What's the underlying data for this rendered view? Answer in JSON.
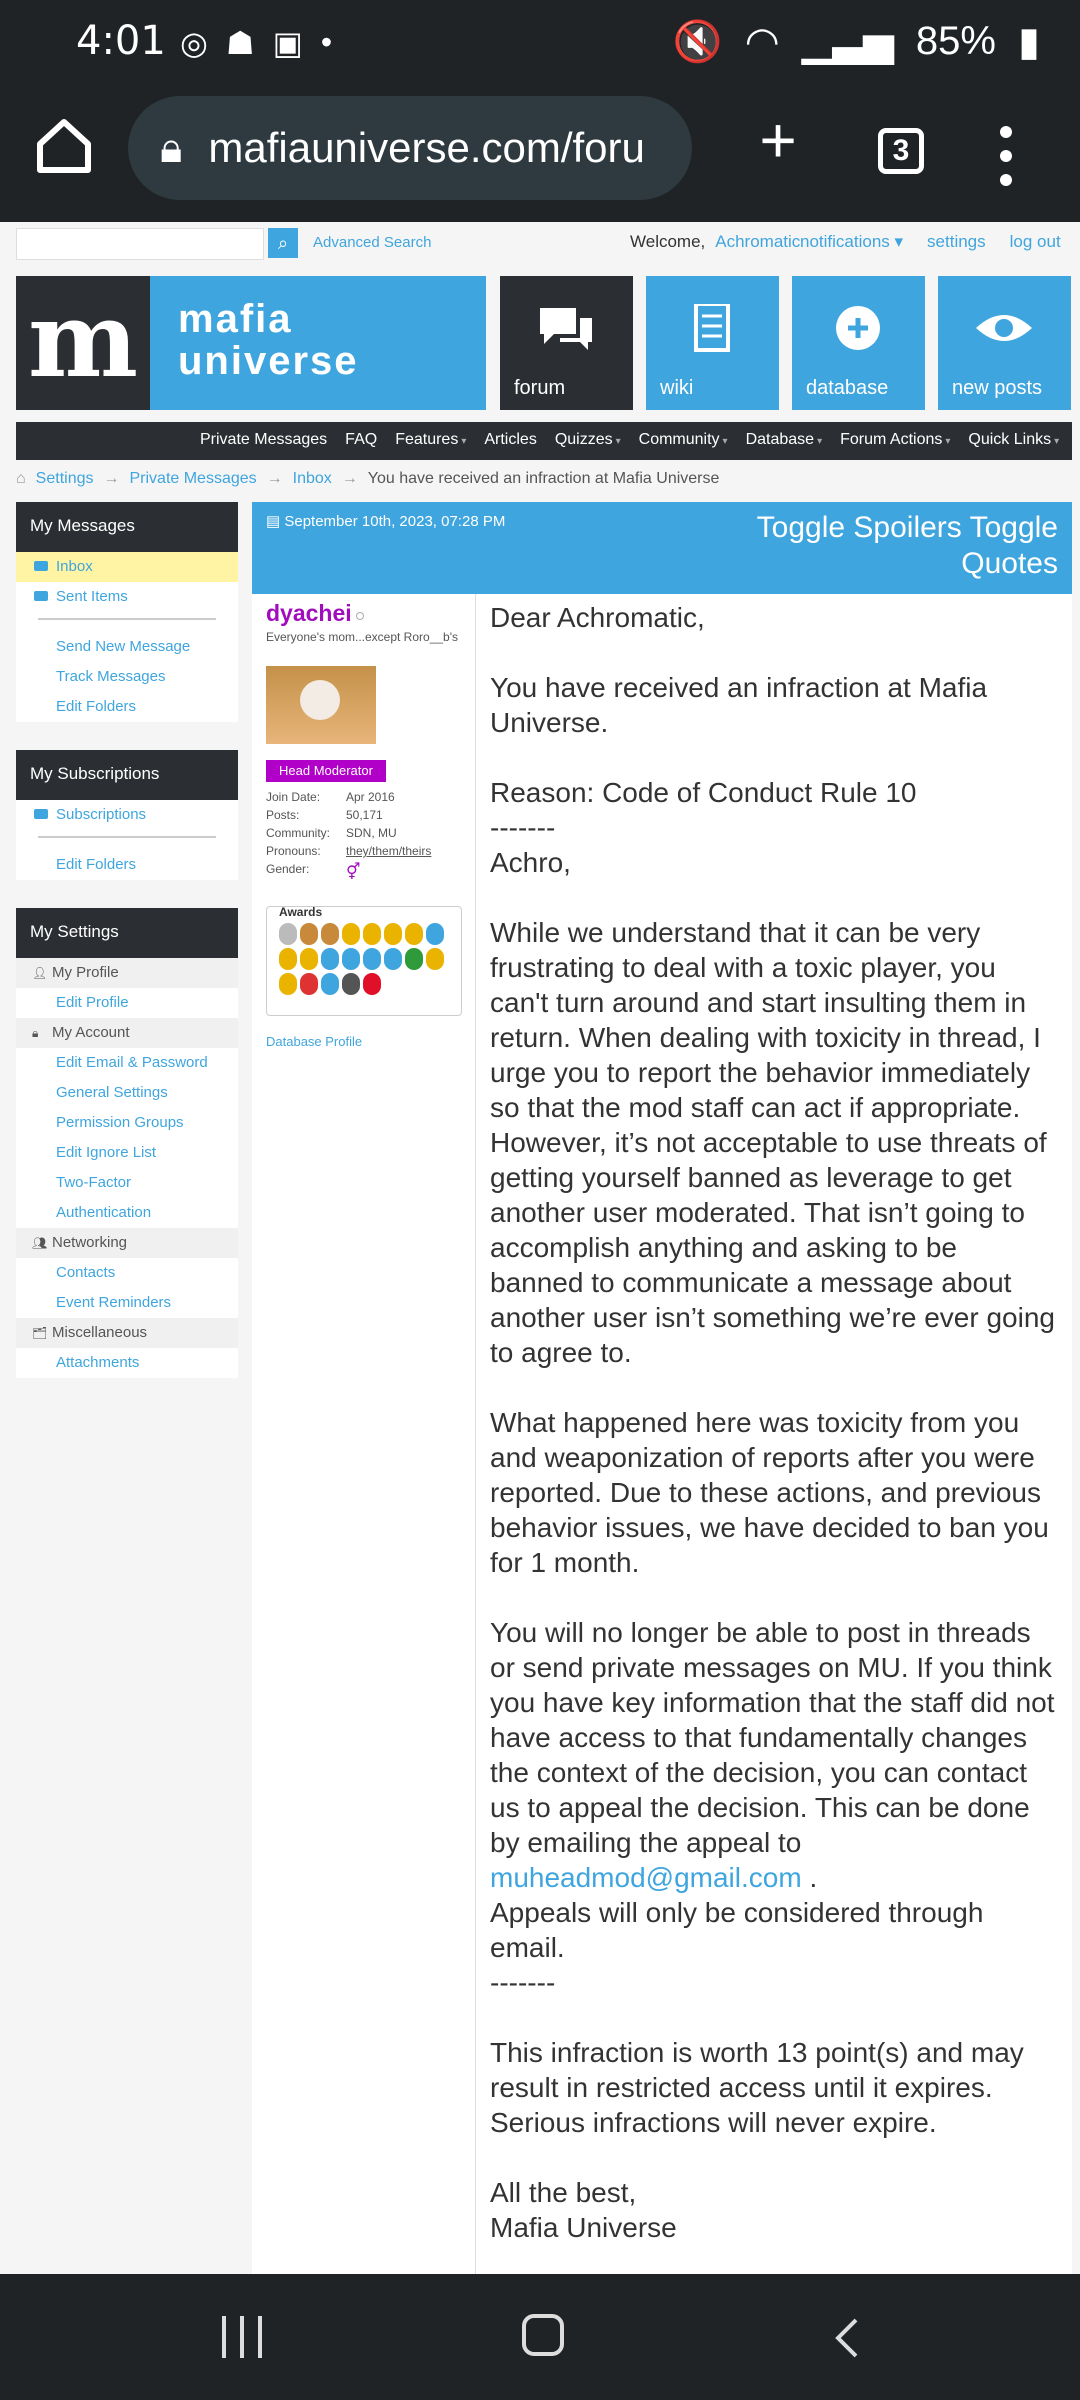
{
  "status_bar": {
    "time": "4:01",
    "battery": "85%"
  },
  "browser": {
    "url": "mafiauniverse.com/foru",
    "tab_count": "3"
  },
  "top": {
    "advanced_search": "Advanced Search",
    "welcome": "Welcome,",
    "username": "Achromatic",
    "notifications": "notifications",
    "settings": "settings",
    "logout": "log out"
  },
  "banner": {
    "logo_line1": "mafia",
    "logo_line2": "universe",
    "tiles": [
      "forum",
      "wiki",
      "database",
      "new posts"
    ]
  },
  "navbar": [
    "Private Messages",
    "FAQ",
    "Features",
    "Articles",
    "Quizzes",
    "Community",
    "Database",
    "Forum Actions",
    "Quick Links"
  ],
  "breadcrumb": {
    "items": [
      "Settings",
      "Private Messages",
      "Inbox"
    ],
    "current": "You have received an infraction at Mafia Universe"
  },
  "sidebar": {
    "messages": {
      "title": "My Messages",
      "inbox": "Inbox",
      "sent": "Sent Items",
      "send_new": "Send New Message",
      "track": "Track Messages",
      "edit_folders": "Edit Folders"
    },
    "subscriptions": {
      "title": "My Subscriptions",
      "subscriptions": "Subscriptions",
      "edit_folders": "Edit Folders"
    },
    "settings": {
      "title": "My Settings",
      "profile_header": "My Profile",
      "edit_profile": "Edit Profile",
      "account_header": "My Account",
      "edit_email": "Edit Email & Password",
      "general": "General Settings",
      "permission": "Permission Groups",
      "ignore": "Edit Ignore List",
      "two_factor": "Two-Factor",
      "authentication": "Authentication",
      "networking_header": "Networking",
      "contacts": "Contacts",
      "event_reminders": "Event Reminders",
      "misc_header": "Miscellaneous",
      "attachments": "Attachments"
    }
  },
  "post": {
    "date": "September 10th, 2023, 07:28 PM",
    "toggles": "Toggle Spoilers Toggle Quotes",
    "user": {
      "name": "dyachei",
      "title": "Everyone's mom...except Roro__b's",
      "badge": "Head Moderator",
      "join_label": "Join Date:",
      "join": "Apr 2016",
      "posts_label": "Posts:",
      "posts": "50,171",
      "community_label": "Community:",
      "community": "SDN, MU",
      "pronouns_label": "Pronouns:",
      "pronouns": "they/them/theirs",
      "gender_label": "Gender:",
      "awards_label": "Awards",
      "db_profile": "Database Profile"
    },
    "body": {
      "p1": "Dear Achromatic,",
      "p2": "You have received an infraction at Mafia Universe.",
      "p3": "Reason: Code of Conduct Rule 10\n-------\nAchro,",
      "p4": "While we understand that it can be very frustrating to deal with a toxic player, you can't turn around and start insulting them in return. When dealing with toxicity in thread, I urge you to report the behavior immediately so that the mod staff can act if appropriate. However, it’s not acceptable to use threats of getting yourself banned as leverage to get another user moderated. That isn’t going to accomplish anything and asking to be banned to communicate a message about another user isn’t something we’re ever going to agree to.",
      "p5": "What happened here was toxicity from you and weaponization of reports after you were reported. Due to these actions, and previous behavior issues, we have decided to ban you for 1 month.",
      "p6a": "You will no longer be able to post in threads or send private messages on MU. If you think you have key information that the staff did not have access to that fundamentally changes the context of the decision, you can contact us to appeal the decision. This can be done by emailing the appeal to ",
      "email": "muheadmod@gmail.com",
      "p6b": " .\nAppeals will only be considered through email.\n-------",
      "p7": "This infraction is worth 13 point(s) and may result in restricted access until it expires. Serious infractions will never expire.",
      "p8": "All the best,\nMafia Universe"
    }
  }
}
